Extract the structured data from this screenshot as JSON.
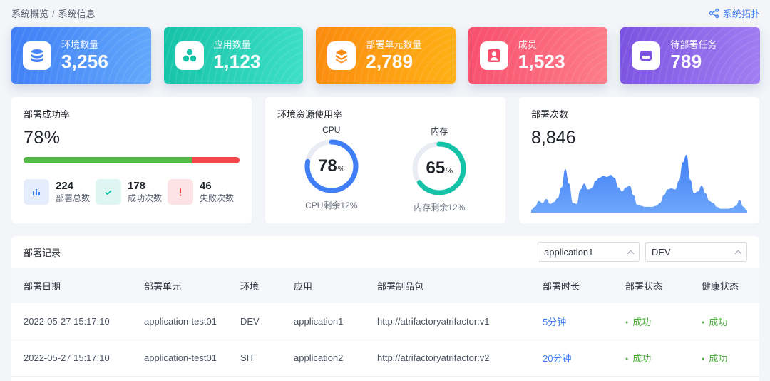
{
  "breadcrumb": {
    "parent": "系统概览",
    "separator": "/",
    "current": "系统信息"
  },
  "topology_link": "系统拓扑",
  "stats": [
    {
      "label": "环境数量",
      "value": "3,256",
      "icon": "database-icon"
    },
    {
      "label": "应用数量",
      "value": "1,123",
      "icon": "apps-icon"
    },
    {
      "label": "部署单元数量",
      "value": "2,789",
      "icon": "layers-icon"
    },
    {
      "label": "成员",
      "value": "1,523",
      "icon": "user-icon"
    },
    {
      "label": "待部署任务",
      "value": "789",
      "icon": "inbox-icon"
    }
  ],
  "success_panel": {
    "title": "部署成功率",
    "rate": "78%",
    "rate_fraction": 0.78,
    "total": {
      "num": "224",
      "label": "部署总数"
    },
    "success": {
      "num": "178",
      "label": "成功次数"
    },
    "fail": {
      "num": "46",
      "label": "失败次数"
    }
  },
  "resource_panel": {
    "title": "环境资源使用率",
    "cpu": {
      "title": "CPU",
      "value": "78",
      "unit": "%",
      "fraction": 0.78,
      "foot": "CPU剩余12%",
      "color": "#3f7ef6"
    },
    "mem": {
      "title": "内存",
      "value": "65",
      "unit": "%",
      "fraction": 0.65,
      "foot": "内存剩余12%",
      "color": "#15c2a7"
    }
  },
  "count_panel": {
    "title": "部署次数",
    "value": "8,846",
    "trend": [
      3,
      6,
      12,
      10,
      14,
      9,
      11,
      15,
      26,
      45,
      30,
      10,
      9,
      24,
      30,
      24,
      25,
      33,
      36,
      38,
      37,
      39,
      36,
      26,
      22,
      26,
      28,
      18,
      8,
      7,
      6,
      6,
      6,
      7,
      10,
      18,
      24,
      25,
      24,
      33,
      52,
      60,
      34,
      20,
      22,
      28,
      20,
      12,
      10,
      6,
      4,
      4,
      4,
      5,
      7,
      13,
      6,
      2
    ]
  },
  "records": {
    "title": "部署记录",
    "filter_app": "application1",
    "filter_env": "DEV",
    "columns": [
      "部署日期",
      "部署单元",
      "环境",
      "应用",
      "部署制品包",
      "部署时长",
      "部署状态",
      "健康状态"
    ],
    "rows": [
      [
        "2022-05-27 15:17:10",
        "application-test01",
        "DEV",
        "application1",
        "http://atrifactoryatrifactor:v1",
        "5分钟",
        "成功",
        "成功"
      ],
      [
        "2022-05-27 15:17:10",
        "application-test01",
        "SIT",
        "application2",
        "http://atrifactoryatrifactor:v2",
        "20分钟",
        "成功",
        "成功"
      ]
    ]
  },
  "colors": {
    "accent": "#3b7cf5",
    "success": "#55b94a",
    "fail": "#f2474b"
  }
}
